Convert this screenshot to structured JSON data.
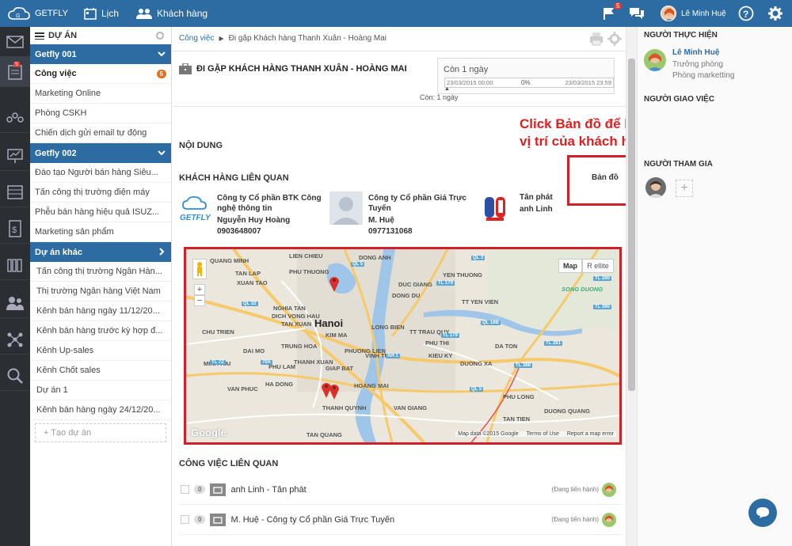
{
  "topbar": {
    "brand": "GETFLY",
    "calendar": "Lịch",
    "customers": "Khách hàng",
    "flag_count": "5",
    "user_name": "Lê Minh Huệ"
  },
  "leftnav": {
    "badge": "5"
  },
  "sidebar": {
    "header": "DỰ ÁN",
    "group1": "Getfly 001",
    "group1_items": [
      "Công việc",
      "Marketing Online",
      "Phòng CSKH",
      "Chiến dịch gửi email tự động"
    ],
    "group1_badge": "5",
    "group2": "Getfly 002",
    "group2_items": [
      "Đào tạo Người bán hàng Siêu...",
      "Tấn công thị trường điện máy",
      "Phễu bán hàng hiệu quả ISUZ...",
      "Marketing sản phẩm"
    ],
    "group3": "Dự án khác",
    "group3_items": [
      "Tấn công thị trường Ngân Hàn...",
      "Thị trường Ngân hàng Việt Nam",
      "Kênh bán hàng ngày 11/12/20...",
      "Kênh bán hàng trước kỳ hợp đ...",
      "Kênh Up-sales",
      "Kênh Chốt sales",
      "Dự án 1",
      "Kênh bán hàng ngày 24/12/20..."
    ],
    "add_project": "+ Tạo dự án"
  },
  "breadcrumb": {
    "root": "Công việc",
    "current": "Đi gặp Khách hàng Thanh Xuân - Hoàng Mai"
  },
  "task": {
    "title": "ĐI GẶP KHÁCH HÀNG THANH XUÂN - HOÀNG MAI",
    "remaining": "Còn 1 ngày",
    "start": "23/03/2015 00:00",
    "end": "23/03/2015 23:59",
    "percent": "0%",
    "remaining_short": "Còn: 1 ngày",
    "progress": 0
  },
  "content": {
    "section_content": "NỘI DUNG",
    "section_customers": "KHÁCH HÀNG LIÊN QUAN",
    "map_link": "Bản đồ",
    "section_tasks": "CÔNG VIỆC LIÊN QUAN"
  },
  "annotation": {
    "line1": "Click Bản đồ để biết chính xác",
    "line2": "vị trí của khách hàng"
  },
  "customers": [
    {
      "company": "Công ty Cổ phần BTK Công nghệ thông tin",
      "contact": "Nguyễn Huy Hoàng",
      "phone": "0903648007",
      "logo": "GETFLY"
    },
    {
      "company": "Công ty Cổ phần Giá Trực Tuyến",
      "contact": "M. Huệ",
      "phone": "0977131068"
    },
    {
      "company": "Tân phát",
      "contact": "anh Linh",
      "phone": ""
    }
  ],
  "map": {
    "type_map": "Map",
    "type_sat": "R ellite",
    "city": "Hanoi",
    "attribution": "Map data ©2015 Google",
    "terms": "Terms of Use",
    "report": "Report a map error",
    "google": "Google",
    "labels": [
      "TAN LAP",
      "PHU THUONG",
      "DONG ANH",
      "DUC GIANG",
      "NGHIA TAN",
      "DICH VONG HAU",
      "TAN XUAN",
      "KIM MA",
      "TRUNG HOA",
      "DAI MO",
      "THANH XUAN",
      "VINH TUY",
      "GIAP BAT",
      "DONG DU",
      "PHU THI",
      "YEN THUONG",
      "KIEU KY",
      "TT YEN VIEN",
      "DA TON",
      "TT TRAU QUY",
      "DUONG XA",
      "PHU LONG",
      "VAN GIANG",
      "DUONG QUANG",
      "TAN TIEN",
      "LONG BIEN",
      "HA DONG",
      "THANH QUYNH",
      "XUAN TAO",
      "VAN PHUC",
      "TAN QUANG",
      "PHU LAM",
      "SONG DUONG",
      "LIEN CHIEU",
      "PHUONG LIEN",
      "CHU TRIEN",
      "MINH HAI",
      "QUANG MINH",
      "HOANG MAI"
    ],
    "roads": [
      "QL 5",
      "QL 3",
      "QL 32",
      "TL 72",
      "TL 179",
      "TL 280",
      "TL 380",
      "QL 18B",
      "TL 281",
      "TL 388",
      "AH 1",
      "70A",
      "QL 5",
      "TL 179"
    ]
  },
  "related_tasks": [
    {
      "name": "anh Linh - Tân phát",
      "status": "(Đang tiến hành)",
      "count": "0"
    },
    {
      "name": "M. Huệ - Công ty Cổ phần Giá Trực Tuyến",
      "status": "(Đang tiến hành)",
      "count": "0"
    }
  ],
  "right": {
    "assignee_title": "NGƯỜI THỰC HIỆN",
    "assignee_name": "Lê Minh Huệ",
    "assignee_role1": "Trưởng phòng",
    "assignee_role2": "Phòng marketting",
    "assigner_title": "NGƯỜI GIAO VIỆC",
    "participants_title": "NGƯỜI THAM GIA"
  }
}
